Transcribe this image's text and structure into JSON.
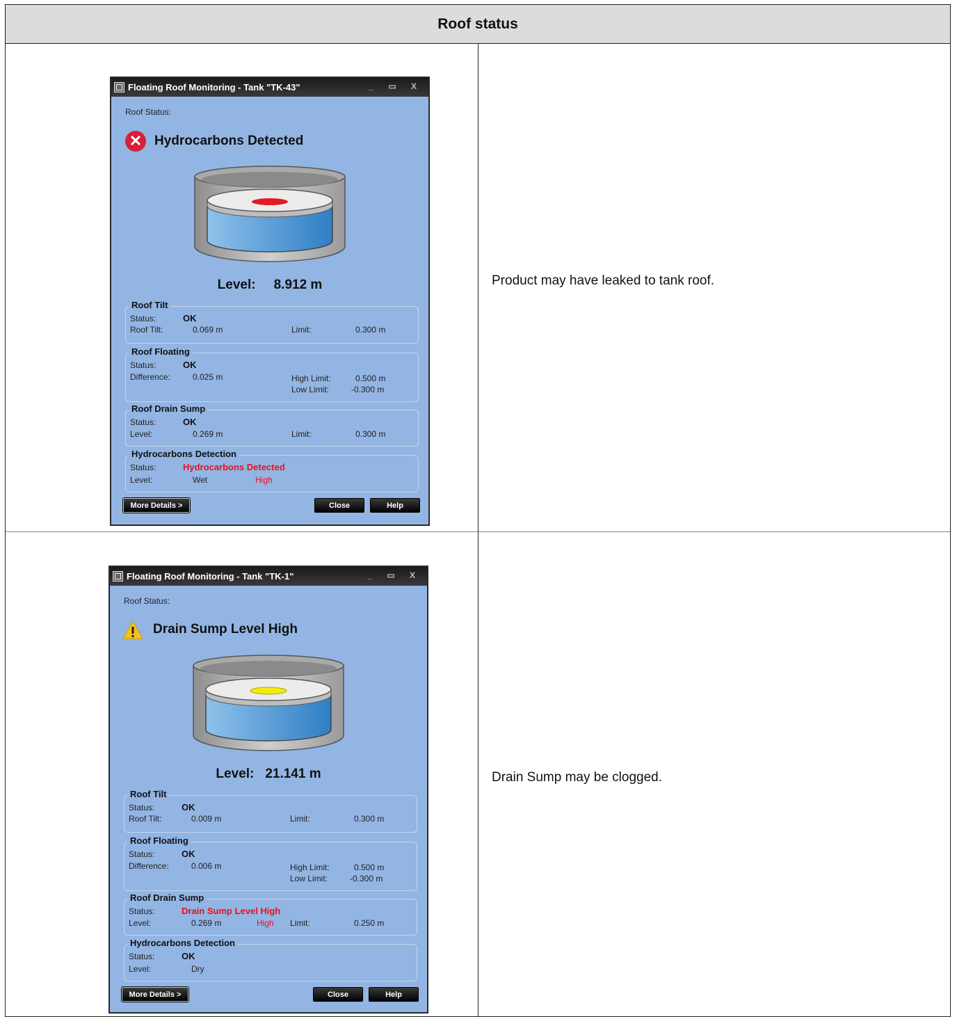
{
  "header": {
    "title": "Roof status"
  },
  "rows": [
    {
      "window": {
        "title": "Floating Roof Monitoring - Tank \"TK-43\"",
        "window_controls": "_ ▭ X",
        "roof_status_label": "Roof Status:",
        "status_icon": "error-circle-icon",
        "status_text": "Hydrocarbons Detected",
        "roof_marker_color": "#e21b22",
        "level_label": "Level:",
        "level_value": "8.912  m",
        "roof_tilt": {
          "title": "Roof Tilt",
          "status_label": "Status:",
          "status_value": "OK",
          "tilt_label": "Roof Tilt:",
          "tilt_value": "0.069  m",
          "limit_label": "Limit:",
          "limit_value": "0.300  m"
        },
        "roof_floating": {
          "title": "Roof Floating",
          "status_label": "Status:",
          "status_value": "OK",
          "diff_label": "Difference:",
          "diff_value": "0.025  m",
          "high_limit_label": "High Limit:",
          "high_limit_value": "0.500  m",
          "low_limit_label": "Low Limit:",
          "low_limit_value": "-0.300  m"
        },
        "roof_drain_sump": {
          "title": "Roof Drain Sump",
          "status_label": "Status:",
          "status_value": "OK",
          "level_label": "Level:",
          "level_value": "0.269  m",
          "level_flag": "",
          "limit_label": "Limit:",
          "limit_value": "0.300  m"
        },
        "hydrocarbons": {
          "title": "Hydrocarbons Detection",
          "status_label": "Status:",
          "status_value": "Hydrocarbons Detected",
          "level_label": "Level:",
          "level_value": "Wet",
          "level_flag": "High"
        },
        "buttons": {
          "more_details": "More Details >",
          "close": "Close",
          "help": "Help"
        }
      },
      "description": "Product may have leaked to tank roof."
    },
    {
      "window": {
        "title": "Floating Roof Monitoring - Tank \"TK-1\"",
        "window_controls": "_ ▭ X",
        "roof_status_label": "Roof Status:",
        "status_icon": "warning-triangle-icon",
        "status_text": "Drain Sump Level High",
        "roof_marker_color": "#f2ea14",
        "level_label": "Level:",
        "level_value": "21.141  m",
        "roof_tilt": {
          "title": "Roof Tilt",
          "status_label": "Status:",
          "status_value": "OK",
          "tilt_label": "Roof Tilt:",
          "tilt_value": "0.009  m",
          "limit_label": "Limit:",
          "limit_value": "0.300  m"
        },
        "roof_floating": {
          "title": "Roof Floating",
          "status_label": "Status:",
          "status_value": "OK",
          "diff_label": "Difference:",
          "diff_value": "0.006  m",
          "high_limit_label": "High Limit:",
          "high_limit_value": "0.500  m",
          "low_limit_label": "Low Limit:",
          "low_limit_value": "-0.300  m"
        },
        "roof_drain_sump": {
          "title": "Roof Drain Sump",
          "status_label": "Status:",
          "status_value": "Drain Sump Level High",
          "level_label": "Level:",
          "level_value": "0.269  m",
          "level_flag": "High",
          "limit_label": "Limit:",
          "limit_value": "0.250  m"
        },
        "hydrocarbons": {
          "title": "Hydrocarbons Detection",
          "status_label": "Status:",
          "status_value": "OK",
          "level_label": "Level:",
          "level_value": "Dry",
          "level_flag": ""
        },
        "buttons": {
          "more_details": "More Details >",
          "close": "Close",
          "help": "Help"
        }
      },
      "description": "Drain Sump may be clogged."
    }
  ]
}
